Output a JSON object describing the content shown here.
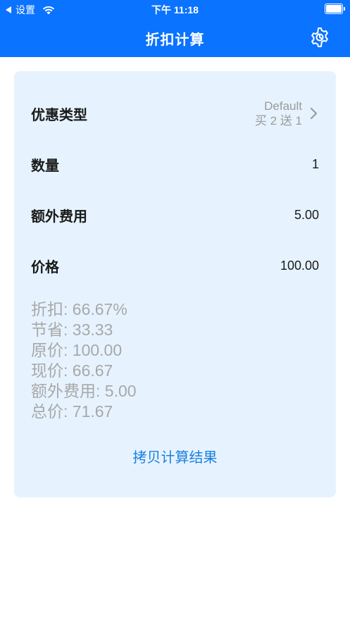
{
  "status_bar": {
    "back_label": "设置",
    "time": "下午 11:18"
  },
  "nav": {
    "title": "折扣计算"
  },
  "form": {
    "discount_type": {
      "label": "优惠类型",
      "value_primary": "Default",
      "value_secondary": "买 2 送 1"
    },
    "quantity": {
      "label": "数量",
      "value": "1"
    },
    "extra_fee": {
      "label": "额外费用",
      "value": "5.00"
    },
    "price": {
      "label": "价格",
      "value": "100.00"
    }
  },
  "summary": {
    "discount": "折扣: 66.67%",
    "saved": "节省: 33.33",
    "original_price": "原价: 100.00",
    "current_price": "现价: 66.67",
    "extra_fee": "额外费用: 5.00",
    "total_price": "总价: 71.67"
  },
  "actions": {
    "copy_label": "拷贝计算结果"
  },
  "colors": {
    "nav_bar": "#0a73ff",
    "card_background": "#e6f3ff",
    "accent_link": "#1a7fe0",
    "muted_text": "#a8a8a8"
  }
}
